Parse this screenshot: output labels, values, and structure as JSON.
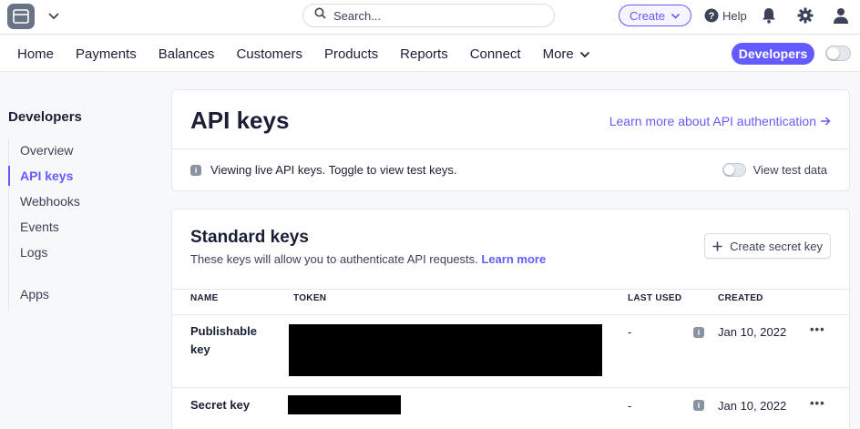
{
  "topbar": {
    "search_placeholder": "Search...",
    "create_label": "Create",
    "help_label": "Help",
    "icons": [
      "store-icon",
      "chevron-down-icon",
      "search-icon",
      "help-icon",
      "bell-icon",
      "gear-icon",
      "user-icon"
    ]
  },
  "nav": {
    "items": [
      "Home",
      "Payments",
      "Balances",
      "Customers",
      "Products",
      "Reports",
      "Connect"
    ],
    "more_label": "More",
    "developers_label": "Developers"
  },
  "sidebar": {
    "title": "Developers",
    "items": [
      {
        "label": "Overview",
        "active": false
      },
      {
        "label": "API keys",
        "active": true
      },
      {
        "label": "Webhooks",
        "active": false
      },
      {
        "label": "Events",
        "active": false
      },
      {
        "label": "Logs",
        "active": false
      },
      {
        "label": "Apps",
        "active": false
      }
    ]
  },
  "header_card": {
    "title": "API keys",
    "learn_link": "Learn more about API authentication",
    "info_text": "Viewing live API keys. Toggle to view test keys.",
    "test_toggle_label": "View test data"
  },
  "standard_keys": {
    "title": "Standard keys",
    "description": "These keys will allow you to authenticate API requests.",
    "learn_more": "Learn more",
    "create_button": "Create secret key",
    "columns": [
      "NAME",
      "TOKEN",
      "LAST USED",
      "CREATED"
    ],
    "rows": [
      {
        "name": "Publishable key",
        "token": "",
        "last_used": "-",
        "created": "Jan 10, 2022"
      },
      {
        "name": "Secret key",
        "token": "",
        "last_used": "-",
        "created": "Jan 10, 2022"
      }
    ]
  },
  "colors": {
    "accent": "#635bff",
    "text": "#1a1f36",
    "muted": "#3c4257",
    "border": "#e3e8ee"
  }
}
